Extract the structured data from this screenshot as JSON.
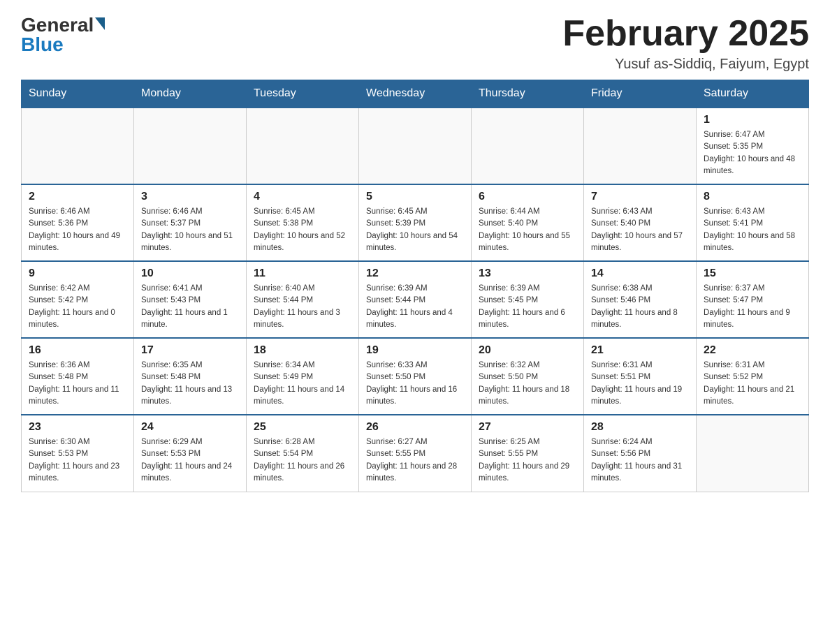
{
  "header": {
    "logo_line1": "General",
    "logo_line2": "Blue",
    "title": "February 2025",
    "subtitle": "Yusuf as-Siddiq, Faiyum, Egypt"
  },
  "days_of_week": [
    "Sunday",
    "Monday",
    "Tuesday",
    "Wednesday",
    "Thursday",
    "Friday",
    "Saturday"
  ],
  "weeks": [
    [
      {
        "day": "",
        "info": ""
      },
      {
        "day": "",
        "info": ""
      },
      {
        "day": "",
        "info": ""
      },
      {
        "day": "",
        "info": ""
      },
      {
        "day": "",
        "info": ""
      },
      {
        "day": "",
        "info": ""
      },
      {
        "day": "1",
        "info": "Sunrise: 6:47 AM\nSunset: 5:35 PM\nDaylight: 10 hours and 48 minutes."
      }
    ],
    [
      {
        "day": "2",
        "info": "Sunrise: 6:46 AM\nSunset: 5:36 PM\nDaylight: 10 hours and 49 minutes."
      },
      {
        "day": "3",
        "info": "Sunrise: 6:46 AM\nSunset: 5:37 PM\nDaylight: 10 hours and 51 minutes."
      },
      {
        "day": "4",
        "info": "Sunrise: 6:45 AM\nSunset: 5:38 PM\nDaylight: 10 hours and 52 minutes."
      },
      {
        "day": "5",
        "info": "Sunrise: 6:45 AM\nSunset: 5:39 PM\nDaylight: 10 hours and 54 minutes."
      },
      {
        "day": "6",
        "info": "Sunrise: 6:44 AM\nSunset: 5:40 PM\nDaylight: 10 hours and 55 minutes."
      },
      {
        "day": "7",
        "info": "Sunrise: 6:43 AM\nSunset: 5:40 PM\nDaylight: 10 hours and 57 minutes."
      },
      {
        "day": "8",
        "info": "Sunrise: 6:43 AM\nSunset: 5:41 PM\nDaylight: 10 hours and 58 minutes."
      }
    ],
    [
      {
        "day": "9",
        "info": "Sunrise: 6:42 AM\nSunset: 5:42 PM\nDaylight: 11 hours and 0 minutes."
      },
      {
        "day": "10",
        "info": "Sunrise: 6:41 AM\nSunset: 5:43 PM\nDaylight: 11 hours and 1 minute."
      },
      {
        "day": "11",
        "info": "Sunrise: 6:40 AM\nSunset: 5:44 PM\nDaylight: 11 hours and 3 minutes."
      },
      {
        "day": "12",
        "info": "Sunrise: 6:39 AM\nSunset: 5:44 PM\nDaylight: 11 hours and 4 minutes."
      },
      {
        "day": "13",
        "info": "Sunrise: 6:39 AM\nSunset: 5:45 PM\nDaylight: 11 hours and 6 minutes."
      },
      {
        "day": "14",
        "info": "Sunrise: 6:38 AM\nSunset: 5:46 PM\nDaylight: 11 hours and 8 minutes."
      },
      {
        "day": "15",
        "info": "Sunrise: 6:37 AM\nSunset: 5:47 PM\nDaylight: 11 hours and 9 minutes."
      }
    ],
    [
      {
        "day": "16",
        "info": "Sunrise: 6:36 AM\nSunset: 5:48 PM\nDaylight: 11 hours and 11 minutes."
      },
      {
        "day": "17",
        "info": "Sunrise: 6:35 AM\nSunset: 5:48 PM\nDaylight: 11 hours and 13 minutes."
      },
      {
        "day": "18",
        "info": "Sunrise: 6:34 AM\nSunset: 5:49 PM\nDaylight: 11 hours and 14 minutes."
      },
      {
        "day": "19",
        "info": "Sunrise: 6:33 AM\nSunset: 5:50 PM\nDaylight: 11 hours and 16 minutes."
      },
      {
        "day": "20",
        "info": "Sunrise: 6:32 AM\nSunset: 5:50 PM\nDaylight: 11 hours and 18 minutes."
      },
      {
        "day": "21",
        "info": "Sunrise: 6:31 AM\nSunset: 5:51 PM\nDaylight: 11 hours and 19 minutes."
      },
      {
        "day": "22",
        "info": "Sunrise: 6:31 AM\nSunset: 5:52 PM\nDaylight: 11 hours and 21 minutes."
      }
    ],
    [
      {
        "day": "23",
        "info": "Sunrise: 6:30 AM\nSunset: 5:53 PM\nDaylight: 11 hours and 23 minutes."
      },
      {
        "day": "24",
        "info": "Sunrise: 6:29 AM\nSunset: 5:53 PM\nDaylight: 11 hours and 24 minutes."
      },
      {
        "day": "25",
        "info": "Sunrise: 6:28 AM\nSunset: 5:54 PM\nDaylight: 11 hours and 26 minutes."
      },
      {
        "day": "26",
        "info": "Sunrise: 6:27 AM\nSunset: 5:55 PM\nDaylight: 11 hours and 28 minutes."
      },
      {
        "day": "27",
        "info": "Sunrise: 6:25 AM\nSunset: 5:55 PM\nDaylight: 11 hours and 29 minutes."
      },
      {
        "day": "28",
        "info": "Sunrise: 6:24 AM\nSunset: 5:56 PM\nDaylight: 11 hours and 31 minutes."
      },
      {
        "day": "",
        "info": ""
      }
    ]
  ]
}
